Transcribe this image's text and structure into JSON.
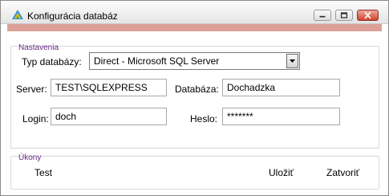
{
  "window": {
    "title": "Konfigurácia databáz"
  },
  "settings": {
    "section_label": "Nastavenia",
    "db_type_label": "Typ databázy:",
    "db_type_value": "Direct - Microsoft SQL Server",
    "server_label": "Server:",
    "server_value": "TEST\\SQLEXPRESS",
    "database_label": "Databáza:",
    "database_value": "Dochadzka",
    "login_label": "Login:",
    "login_value": "doch",
    "password_label": "Heslo:",
    "password_value": "*******"
  },
  "actions": {
    "section_label": "Úkony",
    "test_label": "Test",
    "save_label": "Uložiť",
    "close_label": "Zatvoriť"
  }
}
